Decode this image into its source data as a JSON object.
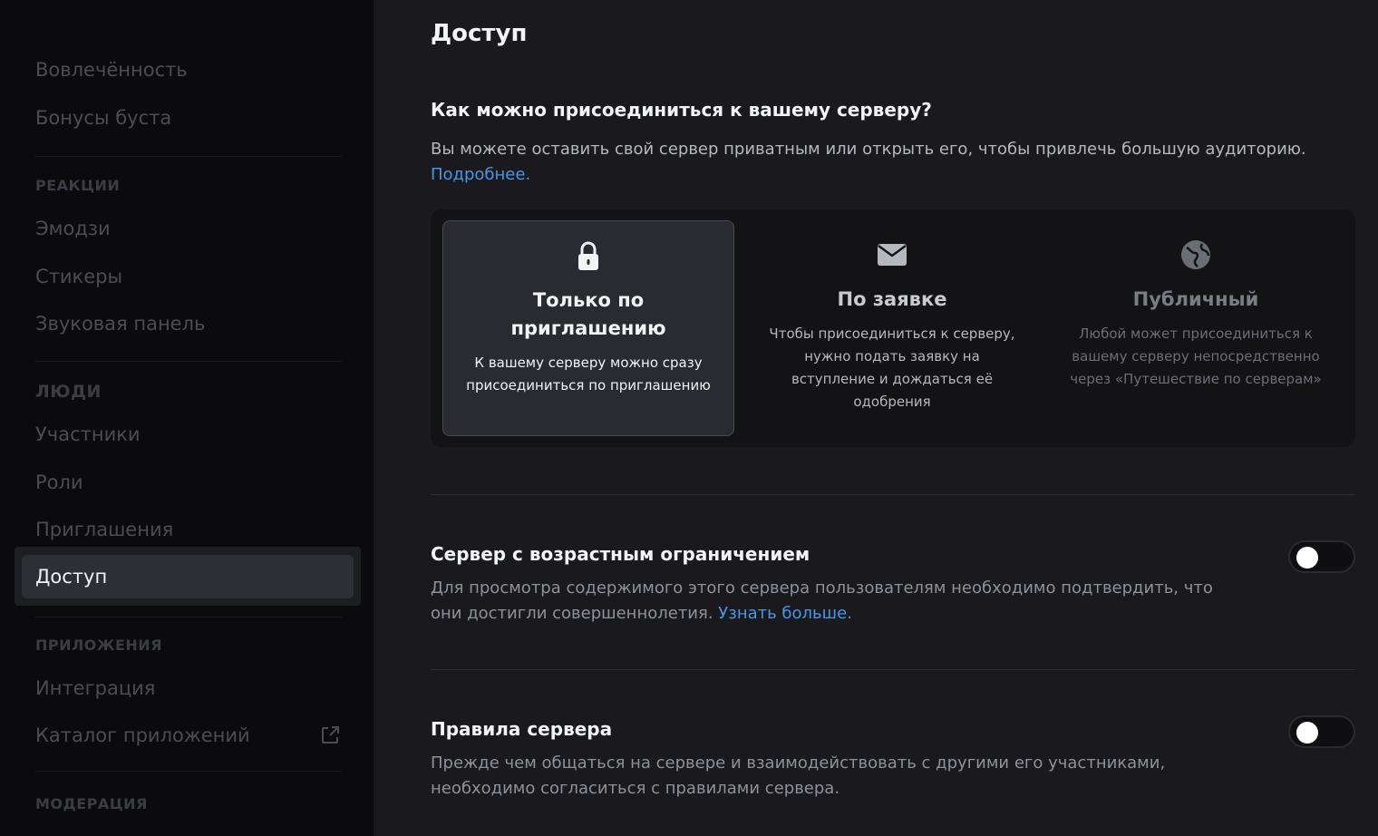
{
  "sidebar": {
    "items_top": [
      {
        "label": "Вовлечённость"
      },
      {
        "label": "Бонусы буста"
      }
    ],
    "sections": [
      {
        "header": "РЕАКЦИИ",
        "items": [
          "Эмодзи",
          "Стикеры",
          "Звуковая панель"
        ]
      },
      {
        "header": "ЛЮДИ",
        "items": [
          "Участники",
          "Роли",
          "Приглашения",
          "Доступ"
        ]
      },
      {
        "header": "ПРИЛОЖЕНИЯ",
        "items": [
          "Интеграция",
          "Каталог приложений"
        ]
      },
      {
        "header": "МОДЕРАЦИЯ",
        "items": []
      }
    ],
    "active_item": "Доступ"
  },
  "main": {
    "title": "Доступ",
    "join_question": "Как можно присоединиться к вашему серверу?",
    "join_desc": "Вы можете оставить свой сервер приватным или открыть его, чтобы привлечь большую аудиторию.",
    "join_link": "Подробнее.",
    "options": [
      {
        "icon": "lock-icon",
        "title": "Только по приглашению",
        "desc": "К вашему серверу можно сразу присоединиться по приглашению",
        "selected": true
      },
      {
        "icon": "envelope-icon",
        "title": "По заявке",
        "desc": "Чтобы присоединиться к серверу, нужно подать заявку на вступление и дождаться её одобрения",
        "selected": false
      },
      {
        "icon": "globe-icon",
        "title": "Публичный",
        "desc": "Любой может присоединиться к вашему серверу непосредственно через «Путешествие по серверам»",
        "selected": false
      }
    ],
    "age_restricted": {
      "title": "Сервер с возрастным ограничением",
      "desc": "Для просмотра содержимого этого сервера пользователям необходимо подтвердить, что они достигли совершеннолетия.",
      "link": "Узнать больше.",
      "enabled": false
    },
    "rules": {
      "title": "Правила сервера",
      "desc": "Прежде чем общаться на сервере и взаимодействовать с другими его участниками, необходимо согласиться с правилами сервера.",
      "enabled": false
    }
  },
  "colors": {
    "accent_link": "#4b95e6",
    "sidebar_bg": "#0b0b0d",
    "main_bg": "#1a1a1e"
  }
}
